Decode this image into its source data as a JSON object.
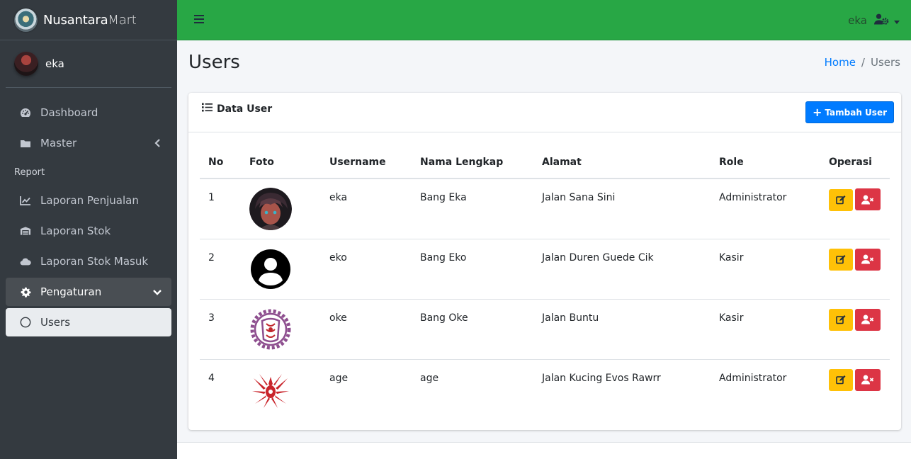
{
  "brand": {
    "name_bold": "Nusantara",
    "name_light": "Mart"
  },
  "sidebar": {
    "user_name": "eka",
    "items": [
      {
        "label": "Dashboard",
        "icon": "tachometer-icon"
      },
      {
        "label": "Master",
        "icon": "folder-icon"
      }
    ],
    "report_header": "Report",
    "report_items": [
      {
        "label": "Laporan Penjualan",
        "icon": "line-chart-icon"
      },
      {
        "label": "Laporan Stok",
        "icon": "warehouse-icon"
      },
      {
        "label": "Laporan Stok Masuk",
        "icon": "cloud-icon"
      },
      {
        "label": "Pengaturan",
        "icon": "gear-icon"
      },
      {
        "label": "Users",
        "icon": "circle-icon"
      }
    ]
  },
  "header": {
    "user_name": "eka"
  },
  "page": {
    "title": "Users",
    "breadcrumb": {
      "home": "Home",
      "current": "Users"
    }
  },
  "card": {
    "title": "Data User",
    "add_button": "Tambah User",
    "columns": [
      "No",
      "Foto",
      "Username",
      "Nama Lengkap",
      "Alamat",
      "Role",
      "Operasi"
    ],
    "rows": [
      {
        "no": "1",
        "username": "eka",
        "nama": "Bang Eka",
        "alamat": "Jalan Sana Sini",
        "role": "Administrator"
      },
      {
        "no": "2",
        "username": "eko",
        "nama": "Bang Eko",
        "alamat": "Jalan Duren Guede Cik",
        "role": "Kasir"
      },
      {
        "no": "3",
        "username": "oke",
        "nama": "Bang Oke",
        "alamat": "Jalan Buntu",
        "role": "Kasir"
      },
      {
        "no": "4",
        "username": "age",
        "nama": "age",
        "alamat": "Jalan Kucing Evos Rawrr",
        "role": "Administrator"
      }
    ]
  },
  "colors": {
    "topbar": "#28a745",
    "sidebar": "#343a40",
    "primary": "#007bff",
    "warning": "#ffc107",
    "danger": "#dc3545"
  }
}
